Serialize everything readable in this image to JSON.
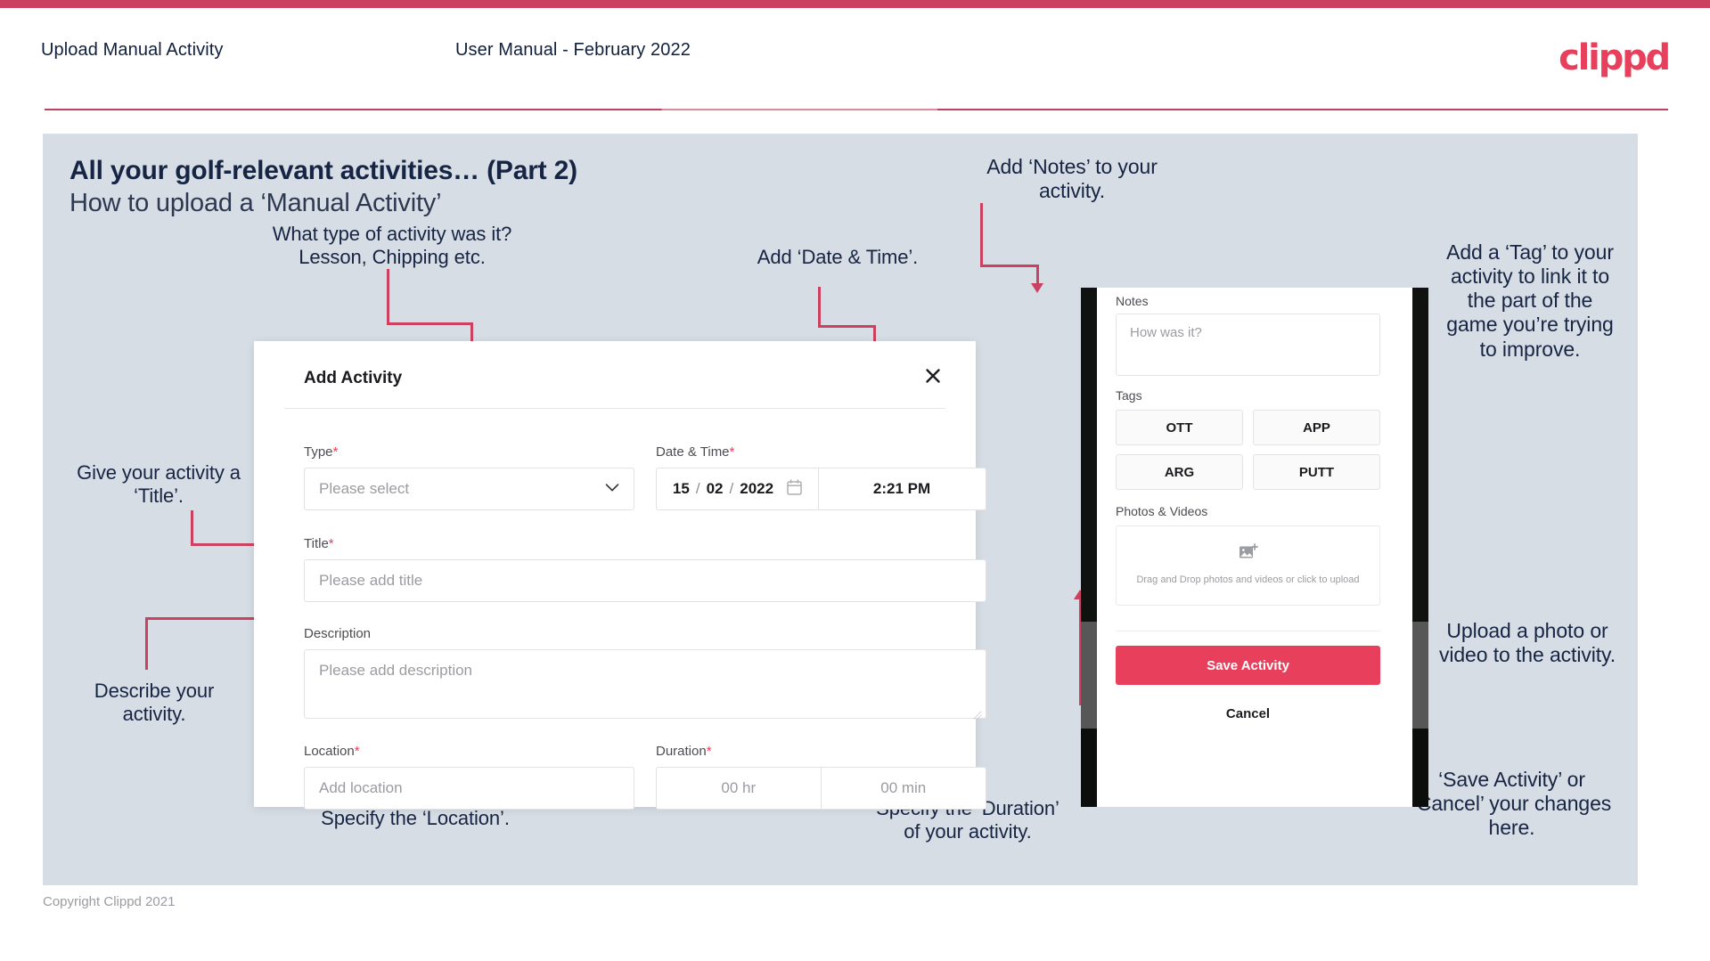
{
  "header": {
    "title": "Upload Manual Activity",
    "subtitle": "User Manual - February 2022",
    "logo": "clippd",
    "accent_color": "#cd4160",
    "brand_color": "#e8405c"
  },
  "slide": {
    "heading": "All your golf-relevant activities… (Part 2)",
    "subheading": "How to upload a ‘Manual Activity’"
  },
  "annotations": {
    "type": "What type of activity was it?\nLesson, Chipping etc.",
    "datetime": "Add ‘Date & Time’.",
    "title": "Give your activity a\n‘Title’.",
    "description": "Describe your\nactivity.",
    "location": "Specify the ‘Location’.",
    "duration": "Specify the ‘Duration’\nof your activity.",
    "notes": "Add ‘Notes’ to your\nactivity.",
    "tags": "Add a ‘Tag’ to your\nactivity to link it to\nthe part of the\ngame you’re trying\nto improve.",
    "upload": "Upload a photo or\nvideo to the activity.",
    "save_cancel": "‘Save Activity’ or\n‘Cancel’ your changes\nhere."
  },
  "dialog": {
    "title": "Add Activity",
    "close_icon": "close-icon",
    "fields": {
      "type": {
        "label": "Type",
        "required": "*",
        "placeholder": "Please select",
        "chevron": "chevron-down-icon"
      },
      "datetime": {
        "label": "Date & Time",
        "required": "*",
        "day": "15",
        "sep1": "/",
        "month": "02",
        "sep2": "/",
        "year": "2022",
        "calendar_icon": "calendar-icon",
        "time": "2:21 PM"
      },
      "title": {
        "label": "Title",
        "required": "*",
        "placeholder": "Please add title"
      },
      "description": {
        "label": "Description",
        "required": "",
        "placeholder": "Please add description"
      },
      "location": {
        "label": "Location",
        "required": "*",
        "placeholder": "Add location"
      },
      "duration": {
        "label": "Duration",
        "required": "*",
        "hours_placeholder": "00 hr",
        "minutes_placeholder": "00 min"
      }
    }
  },
  "phone": {
    "notes": {
      "label": "Notes",
      "placeholder": "How was it?"
    },
    "tags": {
      "label": "Tags",
      "items": [
        "OTT",
        "APP",
        "ARG",
        "PUTT"
      ]
    },
    "photos": {
      "label": "Photos & Videos",
      "icon": "add-image-icon",
      "drop_text": "Drag and Drop photos and videos or click to upload"
    },
    "save_label": "Save Activity",
    "cancel_label": "Cancel"
  },
  "footer": {
    "copyright": "Copyright Clippd 2021"
  }
}
